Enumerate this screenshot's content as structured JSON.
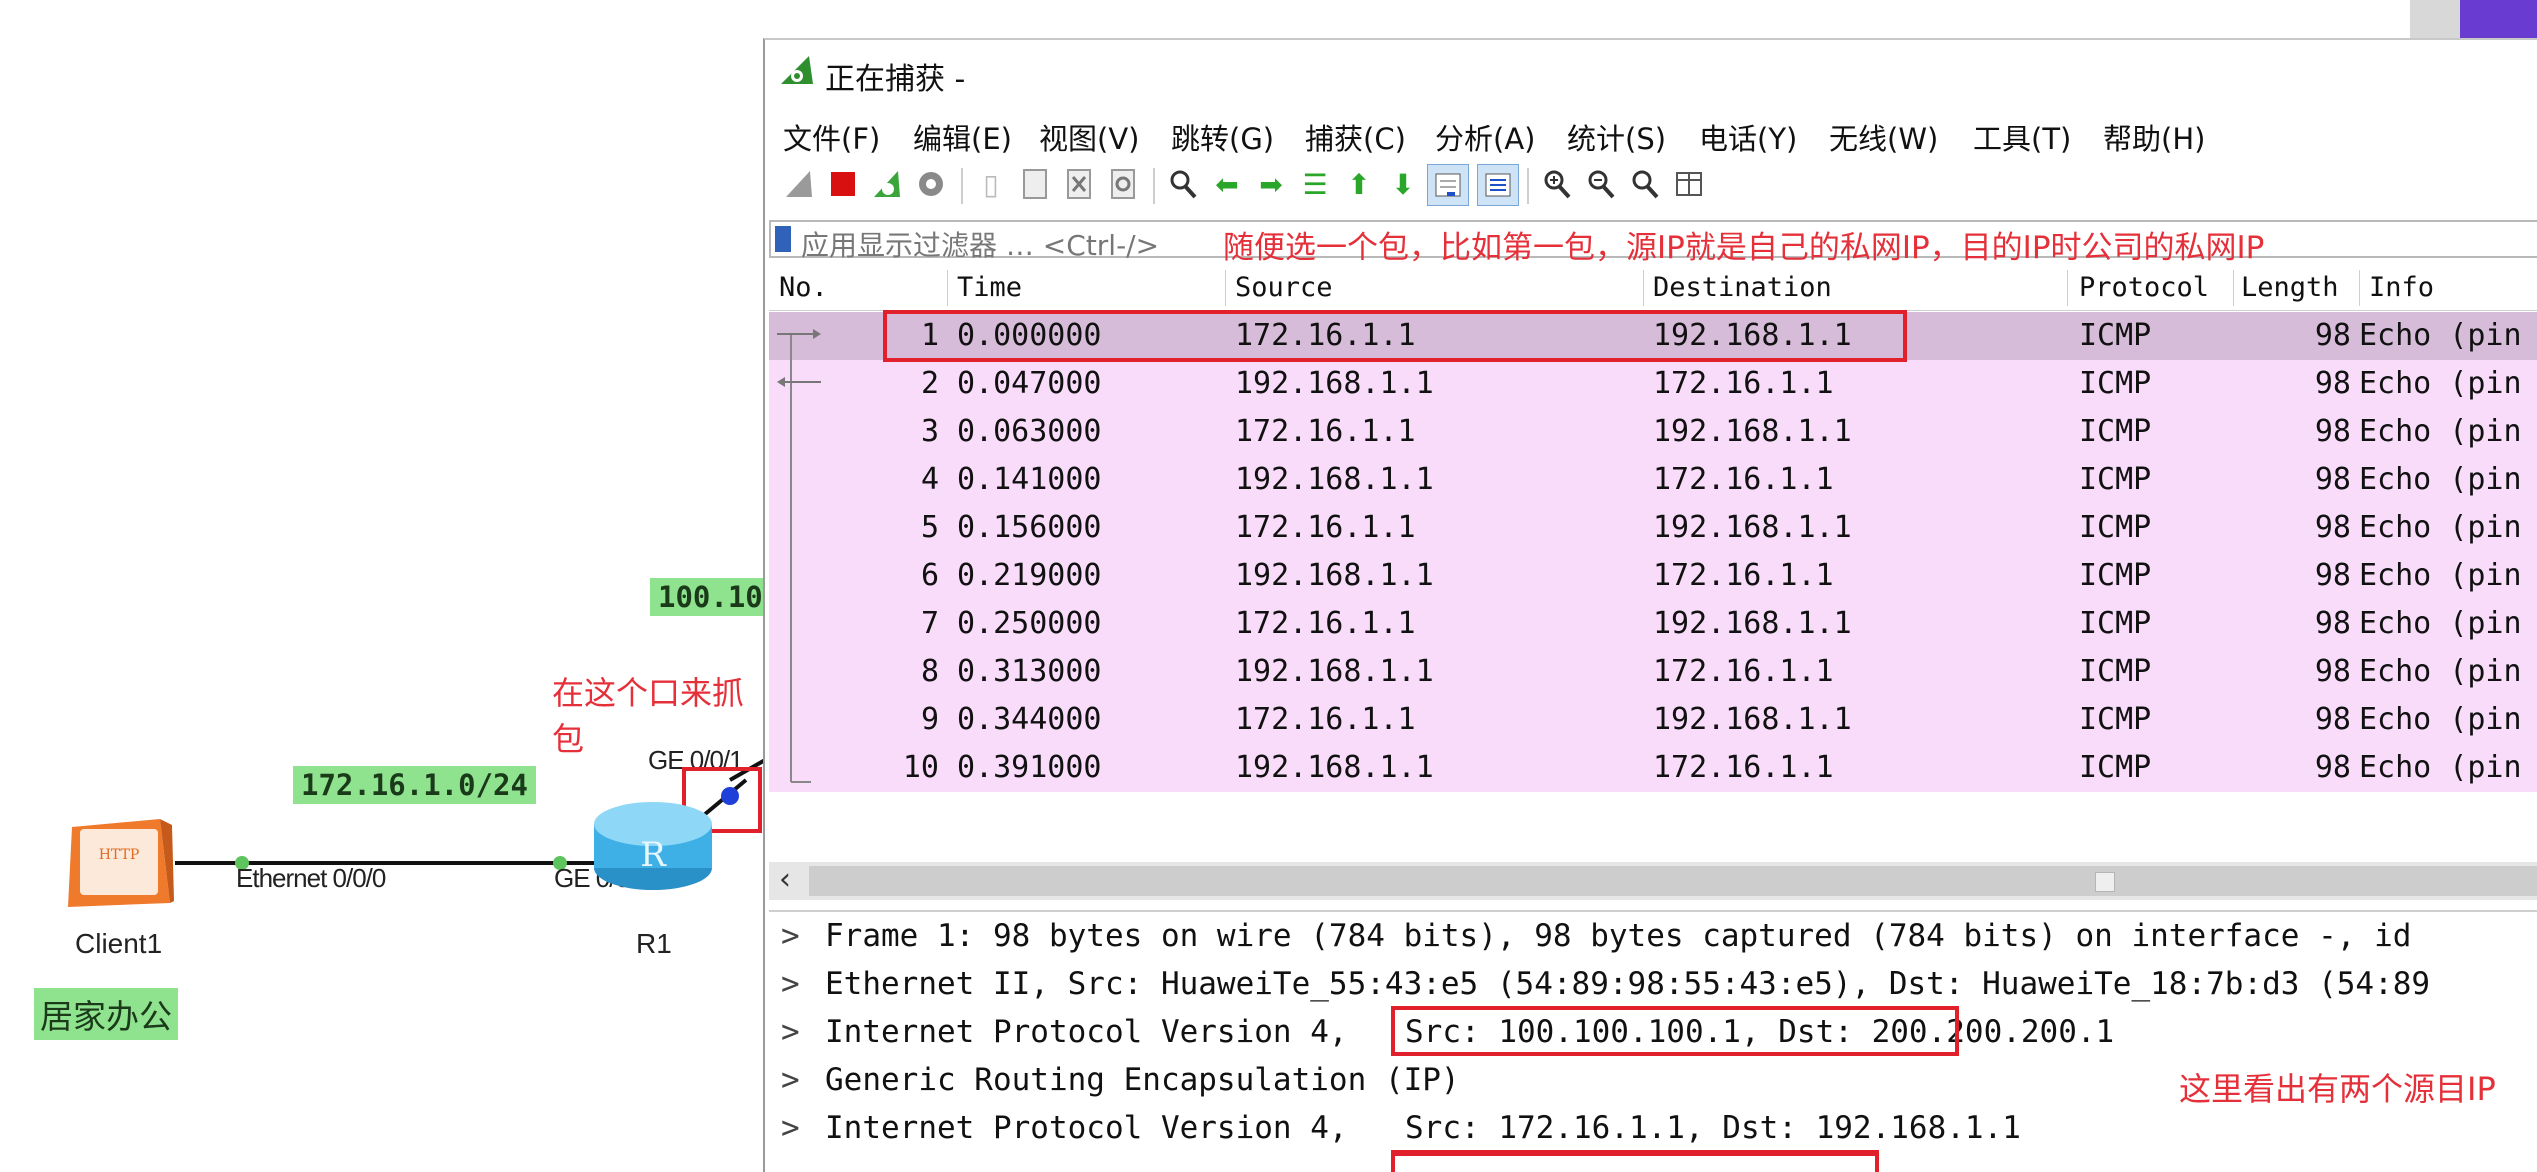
{
  "topology": {
    "net_top": "100.10",
    "net_left": "172.16.1.0/24",
    "capture_note": "在这个口来抓包",
    "port_ge001": "GE 0/0/1",
    "port_eth": "Ethernet 0/0/0",
    "port_ge000": "GE 0/0/0",
    "client_label": "Client1",
    "client_icon_text": "HTTP",
    "router_label": "R1",
    "home_office": "居家办公"
  },
  "window": {
    "title": "正在捕获 -",
    "menu": [
      "文件(F)",
      "编辑(E)",
      "视图(V)",
      "跳转(G)",
      "捕获(C)",
      "分析(A)",
      "统计(S)",
      "电话(Y)",
      "无线(W)",
      "工具(T)",
      "帮助(H)"
    ],
    "filter_placeholder": "应用显示过滤器 … <Ctrl-/>",
    "filter_note": "随便选一个包，比如第一包，源IP就是自己的私网IP，目的IP时公司的私网IP"
  },
  "packet_list": {
    "columns": [
      "No.",
      "Time",
      "Source",
      "Destination",
      "Protocol",
      "Length",
      "Info"
    ],
    "rows": [
      {
        "no": "1",
        "time": "0.000000",
        "src": "172.16.1.1",
        "dst": "192.168.1.1",
        "proto": "ICMP",
        "len": "98",
        "info": "Echo (pin"
      },
      {
        "no": "2",
        "time": "0.047000",
        "src": "192.168.1.1",
        "dst": "172.16.1.1",
        "proto": "ICMP",
        "len": "98",
        "info": "Echo (pin"
      },
      {
        "no": "3",
        "time": "0.063000",
        "src": "172.16.1.1",
        "dst": "192.168.1.1",
        "proto": "ICMP",
        "len": "98",
        "info": "Echo (pin"
      },
      {
        "no": "4",
        "time": "0.141000",
        "src": "192.168.1.1",
        "dst": "172.16.1.1",
        "proto": "ICMP",
        "len": "98",
        "info": "Echo (pin"
      },
      {
        "no": "5",
        "time": "0.156000",
        "src": "172.16.1.1",
        "dst": "192.168.1.1",
        "proto": "ICMP",
        "len": "98",
        "info": "Echo (pin"
      },
      {
        "no": "6",
        "time": "0.219000",
        "src": "192.168.1.1",
        "dst": "172.16.1.1",
        "proto": "ICMP",
        "len": "98",
        "info": "Echo (pin"
      },
      {
        "no": "7",
        "time": "0.250000",
        "src": "172.16.1.1",
        "dst": "192.168.1.1",
        "proto": "ICMP",
        "len": "98",
        "info": "Echo (pin"
      },
      {
        "no": "8",
        "time": "0.313000",
        "src": "192.168.1.1",
        "dst": "172.16.1.1",
        "proto": "ICMP",
        "len": "98",
        "info": "Echo (pin"
      },
      {
        "no": "9",
        "time": "0.344000",
        "src": "172.16.1.1",
        "dst": "192.168.1.1",
        "proto": "ICMP",
        "len": "98",
        "info": "Echo (pin"
      },
      {
        "no": "10",
        "time": "0.391000",
        "src": "192.168.1.1",
        "dst": "172.16.1.1",
        "proto": "ICMP",
        "len": "98",
        "info": "Echo (pin"
      }
    ]
  },
  "details": {
    "frame": "Frame 1: 98 bytes on wire (784 bits), 98 bytes captured (784 bits) on interface -, id",
    "ethernet": "Ethernet II, Src: HuaweiTe_55:43:e5 (54:89:98:55:43:e5), Dst: HuaweiTe_18:7b:d3 (54:89",
    "ip_outer_prefix": "Internet Protocol Version 4,",
    "ip_outer_addrs": "Src: 100.100.100.1, Dst: 200.200.200.1",
    "gre": "Generic Routing Encapsulation (IP)",
    "ip_inner_prefix": "Internet Protocol Version 4,",
    "ip_inner_addrs": "Src: 172.16.1.1, Dst: 192.168.1.1",
    "note_two_src": "这里看出有两个源目IP"
  },
  "colors": {
    "row_bg": "#f8dcf9",
    "row_selected_bg": "#d7bcd9",
    "annotation_red": "#e0202a",
    "net_label_green": "#8fe38f"
  }
}
